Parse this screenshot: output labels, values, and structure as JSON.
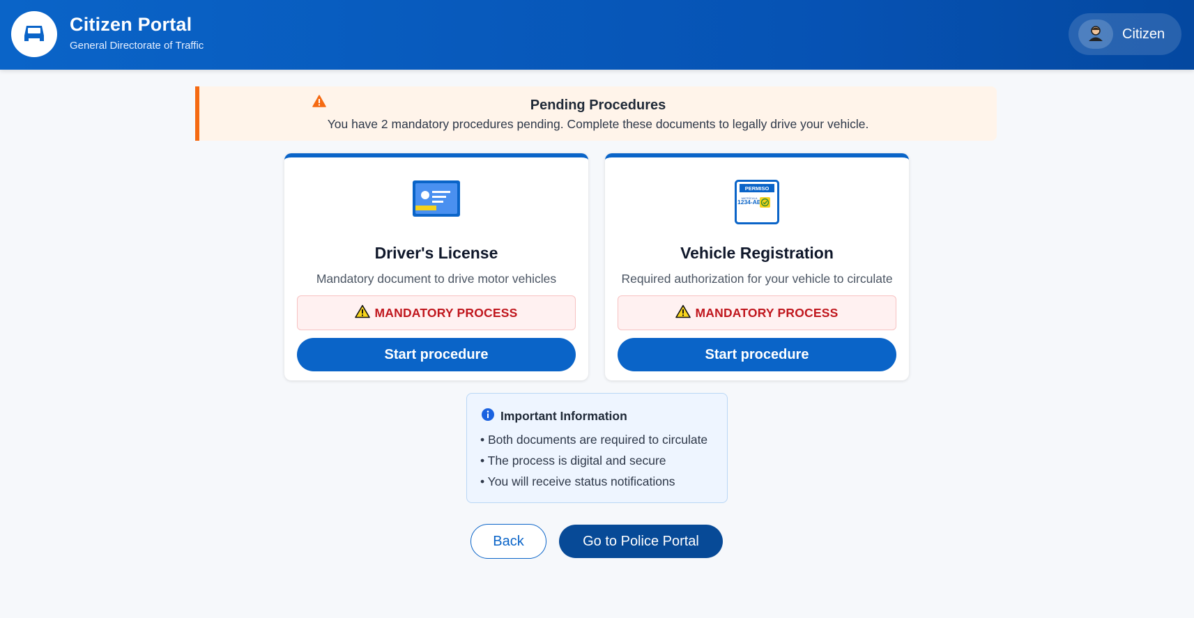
{
  "header": {
    "title": "Citizen Portal",
    "subtitle": "General Directorate of Traffic",
    "logo_icon": "car-icon",
    "user": {
      "label": "Citizen",
      "avatar_icon": "person-icon"
    }
  },
  "alert": {
    "icon": "warning-icon",
    "title": "Pending Procedures",
    "message": "You have 2 mandatory procedures pending. Complete these documents to legally drive your vehicle."
  },
  "cards": [
    {
      "icon": "id-card-icon",
      "title": "Driver's License",
      "description": "Mandatory document to drive motor vehicles",
      "badge": "MANDATORY PROCESS",
      "button": "Start procedure"
    },
    {
      "icon": "vehicle-permit-icon",
      "icon_header": "PERMISO",
      "icon_sublabel": "MATRÍCULA",
      "icon_plate": "1234-ABC",
      "title": "Vehicle Registration",
      "description": "Required authorization for your vehicle to circulate",
      "badge": "MANDATORY PROCESS",
      "button": "Start procedure"
    }
  ],
  "info": {
    "icon": "info-icon",
    "title": "Important Information",
    "items": [
      "• Both documents are required to circulate",
      "• The process is digital and secure",
      "• You will receive status notifications"
    ]
  },
  "actions": {
    "back": "Back",
    "police": "Go to Police Portal"
  },
  "colors": {
    "primary": "#0a64c8",
    "header_dark": "#0448a0",
    "alert_accent": "#f56a12",
    "alert_bg": "#fff4ea",
    "danger": "#c0161d",
    "info_bg": "#eef5ff",
    "police_button": "#074a97"
  }
}
